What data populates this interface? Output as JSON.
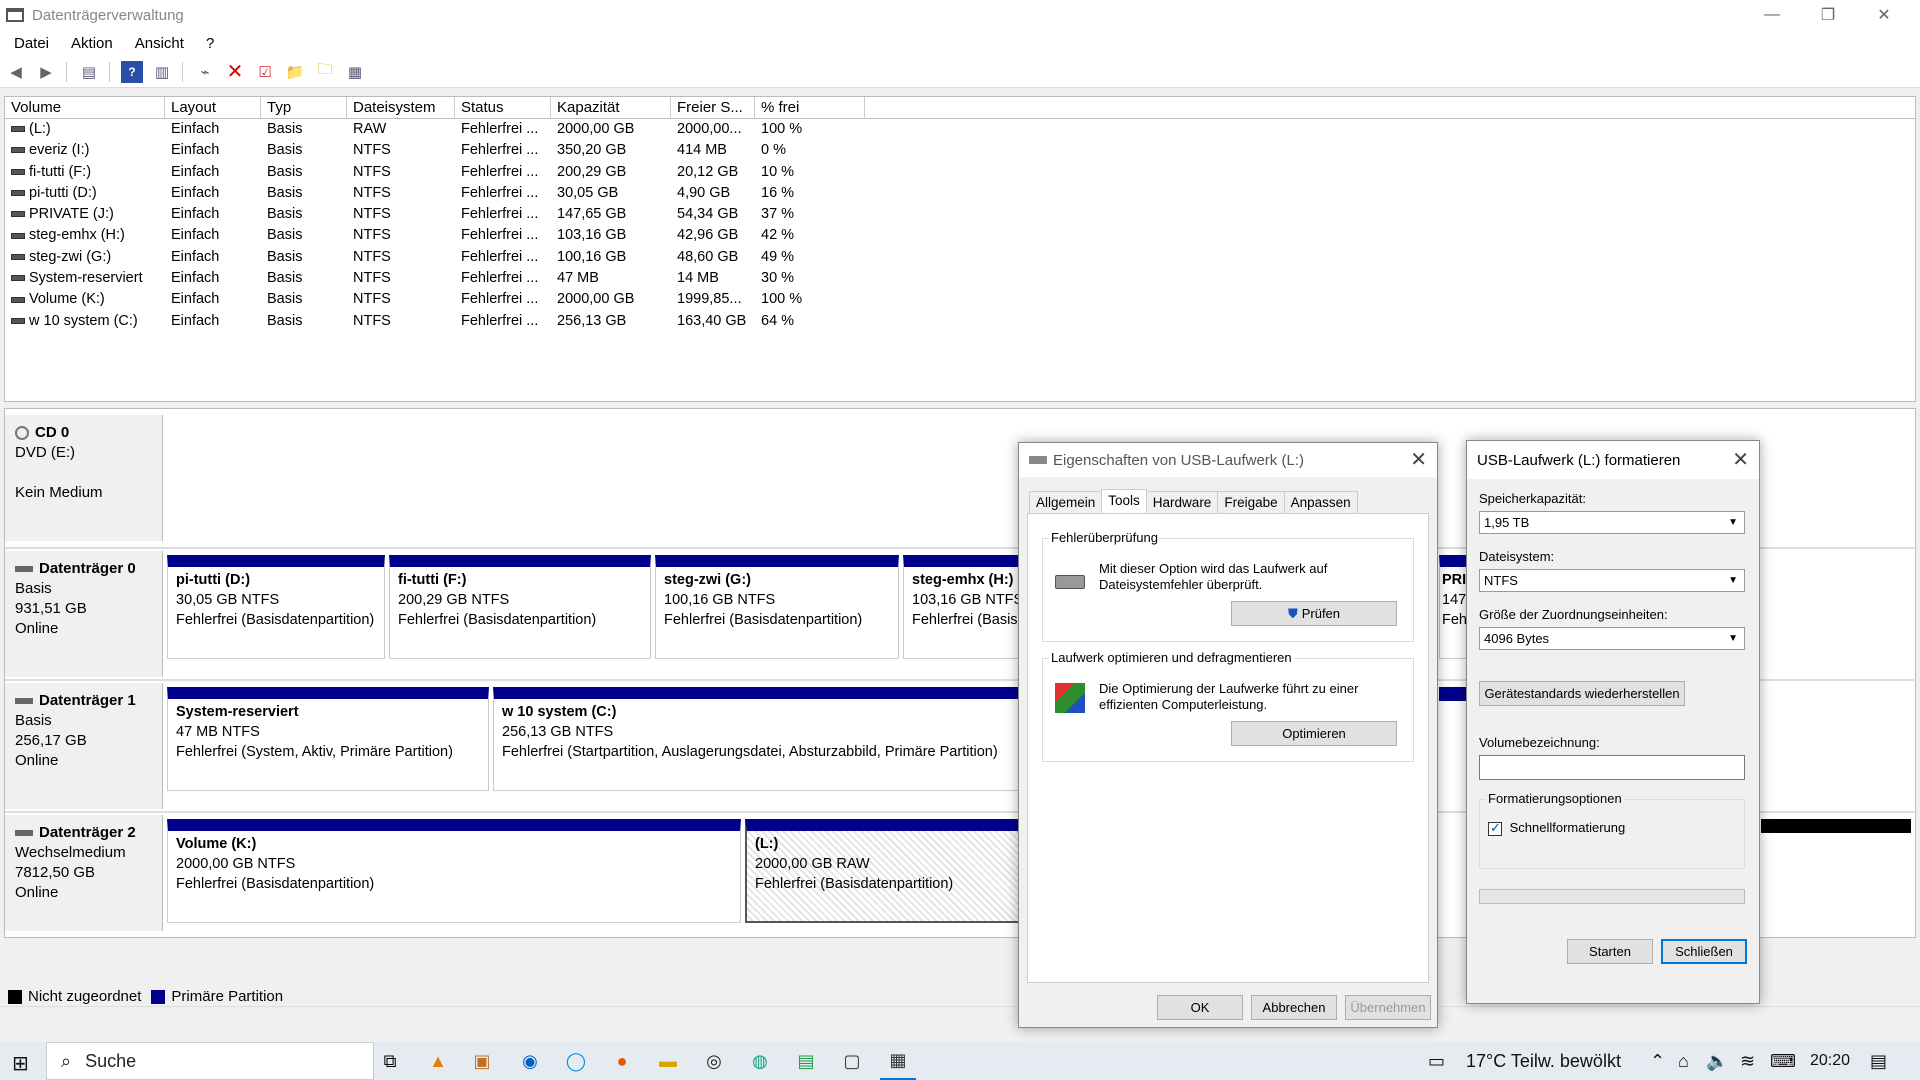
{
  "window": {
    "title": "Datenträgerverwaltung"
  },
  "menu": [
    "Datei",
    "Aktion",
    "Ansicht",
    "?"
  ],
  "volume_table": {
    "headers": [
      "Volume",
      "Layout",
      "Typ",
      "Dateisystem",
      "Status",
      "Kapazität",
      "Freier S...",
      "% frei"
    ],
    "rows": [
      [
        "(L:)",
        "Einfach",
        "Basis",
        "RAW",
        "Fehlerfrei ...",
        "2000,00 GB",
        "2000,00...",
        "100 %"
      ],
      [
        "everiz (I:)",
        "Einfach",
        "Basis",
        "NTFS",
        "Fehlerfrei ...",
        "350,20 GB",
        "414 MB",
        "0 %"
      ],
      [
        "fi-tutti (F:)",
        "Einfach",
        "Basis",
        "NTFS",
        "Fehlerfrei ...",
        "200,29 GB",
        "20,12 GB",
        "10 %"
      ],
      [
        "pi-tutti (D:)",
        "Einfach",
        "Basis",
        "NTFS",
        "Fehlerfrei ...",
        "30,05 GB",
        "4,90 GB",
        "16 %"
      ],
      [
        "PRIVATE (J:)",
        "Einfach",
        "Basis",
        "NTFS",
        "Fehlerfrei ...",
        "147,65 GB",
        "54,34 GB",
        "37 %"
      ],
      [
        "steg-emhx (H:)",
        "Einfach",
        "Basis",
        "NTFS",
        "Fehlerfrei ...",
        "103,16 GB",
        "42,96 GB",
        "42 %"
      ],
      [
        "steg-zwi (G:)",
        "Einfach",
        "Basis",
        "NTFS",
        "Fehlerfrei ...",
        "100,16 GB",
        "48,60 GB",
        "49 %"
      ],
      [
        "System-reserviert",
        "Einfach",
        "Basis",
        "NTFS",
        "Fehlerfrei ...",
        "47 MB",
        "14 MB",
        "30 %"
      ],
      [
        "Volume (K:)",
        "Einfach",
        "Basis",
        "NTFS",
        "Fehlerfrei ...",
        "2000,00 GB",
        "1999,85...",
        "100 %"
      ],
      [
        "w 10 system (C:)",
        "Einfach",
        "Basis",
        "NTFS",
        "Fehlerfrei ...",
        "256,13 GB",
        "163,40 GB",
        "64 %"
      ]
    ]
  },
  "disks": {
    "cd0": {
      "name": "CD 0",
      "line1": "DVD (E:)",
      "line2": "",
      "line3": "Kein Medium"
    },
    "d0": {
      "name": "Datenträger 0",
      "type": "Basis",
      "size": "931,51 GB",
      "state": "Online"
    },
    "d1": {
      "name": "Datenträger 1",
      "type": "Basis",
      "size": "256,17 GB",
      "state": "Online"
    },
    "d2": {
      "name": "Datenträger 2",
      "type": "Wechselmedium",
      "size": "7812,50 GB",
      "state": "Online"
    }
  },
  "partitions": {
    "p_d": {
      "name": "pi-tutti  (D:)",
      "size": "30,05 GB NTFS",
      "status": "Fehlerfrei (Basisdatenpartition)"
    },
    "p_f": {
      "name": "fi-tutti  (F:)",
      "size": "200,29 GB NTFS",
      "status": "Fehlerfrei (Basisdatenpartition)"
    },
    "p_g": {
      "name": "steg-zwi  (G:)",
      "size": "100,16 GB NTFS",
      "status": "Fehlerfrei (Basisdatenpartition)"
    },
    "p_h": {
      "name": "steg-emhx  (H:)",
      "size": "103,16 GB NTFS",
      "status": "Fehlerfrei (Basisd"
    },
    "p_j": {
      "name": "PRIV",
      "size": "147,6",
      "status": "Fehle"
    },
    "p_sys": {
      "name": "System-reserviert",
      "size": "47 MB NTFS",
      "status": "Fehlerfrei (System, Aktiv, Primäre Partition)"
    },
    "p_c": {
      "name": "w 10 system  (C:)",
      "size": "256,13 GB NTFS",
      "status": "Fehlerfrei (Startpartition, Auslagerungsdatei, Absturzabbild, Primäre Partition)"
    },
    "p_k": {
      "name": "Volume  (K:)",
      "size": "2000,00 GB NTFS",
      "status": "Fehlerfrei (Basisdatenpartition)"
    },
    "p_l": {
      "name": " (L:)",
      "size": "2000,00 GB RAW",
      "status": "Fehlerfrei (Basisdatenpartition)"
    }
  },
  "legend": {
    "unallocated": "Nicht zugeordnet",
    "primary": "Primäre Partition"
  },
  "colors": {
    "primary_partition": "#00008b",
    "unallocated": "#000000",
    "accent": "#0078d7"
  },
  "properties_dialog": {
    "title": "Eigenschaften von USB-Laufwerk (L:)",
    "tabs": [
      "Allgemein",
      "Tools",
      "Hardware",
      "Freigabe",
      "Anpassen"
    ],
    "active_tab": "Tools",
    "error_group": {
      "title": "Fehlerüberprüfung",
      "text1": "Mit dieser Option wird das Laufwerk auf",
      "text2": "Dateisystemfehler überprüft.",
      "button": "Prüfen"
    },
    "optimize_group": {
      "title": "Laufwerk optimieren und defragmentieren",
      "text1": "Die Optimierung der Laufwerke führt zu einer",
      "text2": "effizienten Computerleistung.",
      "button": "Optimieren"
    },
    "ok": "OK",
    "cancel": "Abbrechen",
    "apply": "Übernehmen"
  },
  "format_dialog": {
    "title": "USB-Laufwerk (L:) formatieren",
    "capacity_label": "Speicherkapazität:",
    "capacity_value": "1,95 TB",
    "fs_label": "Dateisystem:",
    "fs_value": "NTFS",
    "alloc_label": "Größe der Zuordnungseinheiten:",
    "alloc_value": "4096 Bytes",
    "restore_button": "Gerätestandards wiederherstellen",
    "volume_label": "Volumebezeichnung:",
    "volume_value": "",
    "options_title": "Formatierungsoptionen",
    "quick_format": "Schnellformatierung",
    "quick_format_checked": true,
    "progress": 0,
    "start": "Starten",
    "close": "Schließen"
  },
  "taskbar": {
    "search_placeholder": "Suche",
    "weather": "17°C  Teilw. bewölkt",
    "time": "20:20"
  }
}
